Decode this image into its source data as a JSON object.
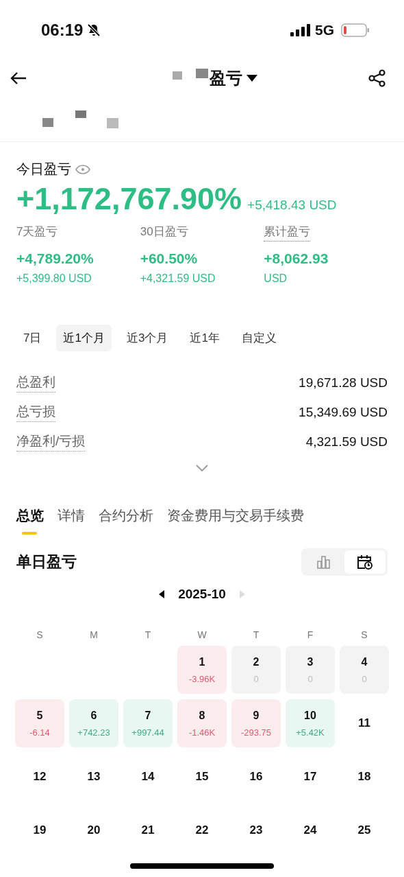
{
  "status_bar": {
    "time": "06:19",
    "network": "5G"
  },
  "header": {
    "title": "盈亏"
  },
  "today": {
    "label": "今日盈亏",
    "percent": "+1,172,767.90%",
    "amount": "+5,418.43 USD"
  },
  "summaries": [
    {
      "label": "7天盈亏",
      "value": "+4,789.20%",
      "sub": "+5,399.80 USD",
      "dotted": false
    },
    {
      "label": "30日盈亏",
      "value": "+60.50%",
      "sub": "+4,321.59 USD",
      "dotted": false
    },
    {
      "label": "累计盈亏",
      "value": "+8,062.93",
      "sub": "USD",
      "dotted": true
    }
  ],
  "ranges": [
    {
      "label": "7日",
      "selected": false
    },
    {
      "label": "近1个月",
      "selected": true
    },
    {
      "label": "近3个月",
      "selected": false
    },
    {
      "label": "近1年",
      "selected": false
    },
    {
      "label": "自定义",
      "selected": false
    }
  ],
  "stats": [
    {
      "label": "总盈利",
      "value": "19,671.28 USD"
    },
    {
      "label": "总亏损",
      "value": "15,349.69 USD"
    },
    {
      "label": "净盈利/亏损",
      "value": "4,321.59 USD"
    }
  ],
  "tabs": [
    {
      "label": "总览",
      "selected": true
    },
    {
      "label": "详情",
      "selected": false
    },
    {
      "label": "合约分析",
      "selected": false
    },
    {
      "label": "资金费用与交易手续费",
      "selected": false
    }
  ],
  "daily": {
    "title": "单日盈亏",
    "views": [
      {
        "kind": "chart",
        "selected": false
      },
      {
        "kind": "calendar",
        "selected": true
      }
    ],
    "month": "2025-10",
    "weekdays": [
      "S",
      "M",
      "T",
      "W",
      "T",
      "F",
      "S"
    ],
    "weeks": [
      [
        {
          "kind": "empty"
        },
        {
          "kind": "empty"
        },
        {
          "kind": "empty"
        },
        {
          "day": "1",
          "pnl": "-3.96K",
          "kind": "loss"
        },
        {
          "day": "2",
          "pnl": "0",
          "kind": "flat"
        },
        {
          "day": "3",
          "pnl": "0",
          "kind": "flat"
        },
        {
          "day": "4",
          "pnl": "0",
          "kind": "flat"
        }
      ],
      [
        {
          "day": "5",
          "pnl": "-6.14",
          "kind": "loss"
        },
        {
          "day": "6",
          "pnl": "+742.23",
          "kind": "gain"
        },
        {
          "day": "7",
          "pnl": "+997.44",
          "kind": "gain"
        },
        {
          "day": "8",
          "pnl": "-1.46K",
          "kind": "loss"
        },
        {
          "day": "9",
          "pnl": "-293.75",
          "kind": "loss"
        },
        {
          "day": "10",
          "pnl": "+5.42K",
          "kind": "gain"
        },
        {
          "day": "11",
          "kind": "plain"
        }
      ],
      [
        {
          "day": "12",
          "kind": "plain"
        },
        {
          "day": "13",
          "kind": "plain"
        },
        {
          "day": "14",
          "kind": "plain"
        },
        {
          "day": "15",
          "kind": "plain"
        },
        {
          "day": "16",
          "kind": "plain"
        },
        {
          "day": "17",
          "kind": "plain"
        },
        {
          "day": "18",
          "kind": "plain"
        }
      ],
      [
        {
          "day": "19",
          "kind": "plain"
        },
        {
          "day": "20",
          "kind": "plain"
        },
        {
          "day": "21",
          "kind": "plain"
        },
        {
          "day": "22",
          "kind": "plain"
        },
        {
          "day": "23",
          "kind": "plain"
        },
        {
          "day": "24",
          "kind": "plain"
        },
        {
          "day": "25",
          "kind": "plain"
        }
      ]
    ]
  }
}
